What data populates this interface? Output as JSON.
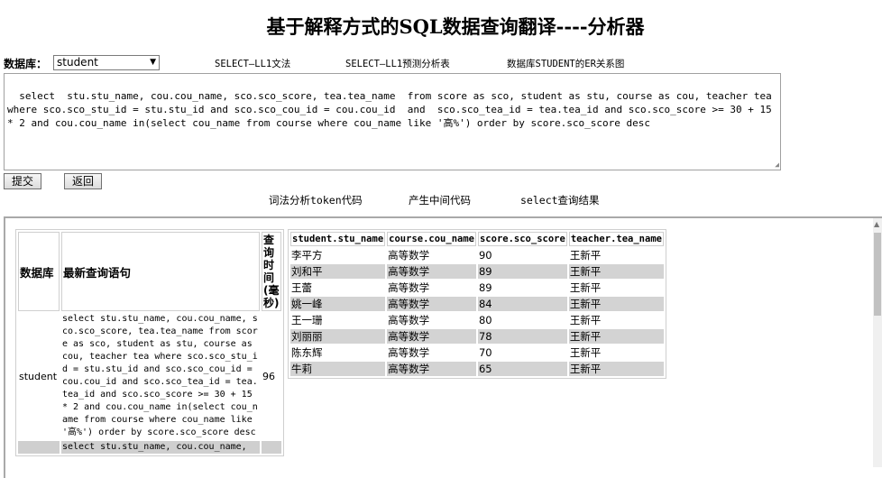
{
  "page_title": "基于解释方式的SQL数据查询翻译----分析器",
  "db": {
    "label": "数据库：",
    "selected": "student"
  },
  "top_links": [
    "SELECT—LL1文法",
    "SELECT—LL1预测分析表",
    "数据库STUDENT的ER关系图"
  ],
  "sql_input": "select  stu.stu_name, cou.cou_name, sco.sco_score, tea.tea_name  from score as sco, student as stu, course as cou, teacher tea where sco.sco_stu_id = stu.stu_id and sco.sco_cou_id = cou.cou_id  and  sco.sco_tea_id = tea.tea_id and sco.sco_score >= 30 + 15 * 2 and cou.cou_name in(select cou_name from course where cou_name like '高%') order by score.sco_score desc",
  "buttons": {
    "submit": "提交",
    "back": "返回"
  },
  "sub_links": [
    "词法分析token代码",
    "产生中间代码",
    "select查询结果"
  ],
  "history": {
    "headers": {
      "db": "数据库",
      "query": "最新查询语句",
      "time": "查询时间(毫秒)"
    },
    "rows": [
      {
        "db": "student",
        "query": "select stu.stu_name, cou.cou_name, sco.sco_score, tea.tea_name from score as sco, student as stu, course as cou, teacher tea where sco.sco_stu_id = stu.stu_id and sco.sco_cou_id = cou.cou_id and sco.sco_tea_id = tea.tea_id and sco.sco_score >= 30 + 15 * 2 and cou.cou_name in(select cou_name from course where cou_name like '高%') order by score.sco_score desc",
        "time": "96"
      },
      {
        "db": "",
        "query": "select stu.stu_name, cou.cou_name,",
        "time": ""
      }
    ]
  },
  "results": {
    "headers": [
      "student.stu_name",
      "course.cou_name",
      "score.sco_score",
      "teacher.tea_name"
    ],
    "rows": [
      [
        "李平方",
        "高等数学",
        "90",
        "王新平"
      ],
      [
        "刘和平",
        "高等数学",
        "89",
        "王新平"
      ],
      [
        "王蕾",
        "高等数学",
        "89",
        "王新平"
      ],
      [
        "姚一峰",
        "高等数学",
        "84",
        "王新平"
      ],
      [
        "王一珊",
        "高等数学",
        "80",
        "王新平"
      ],
      [
        "刘丽丽",
        "高等数学",
        "78",
        "王新平"
      ],
      [
        "陈东辉",
        "高等数学",
        "70",
        "王新平"
      ],
      [
        "牛莉",
        "高等数学",
        "65",
        "王新平"
      ]
    ]
  }
}
